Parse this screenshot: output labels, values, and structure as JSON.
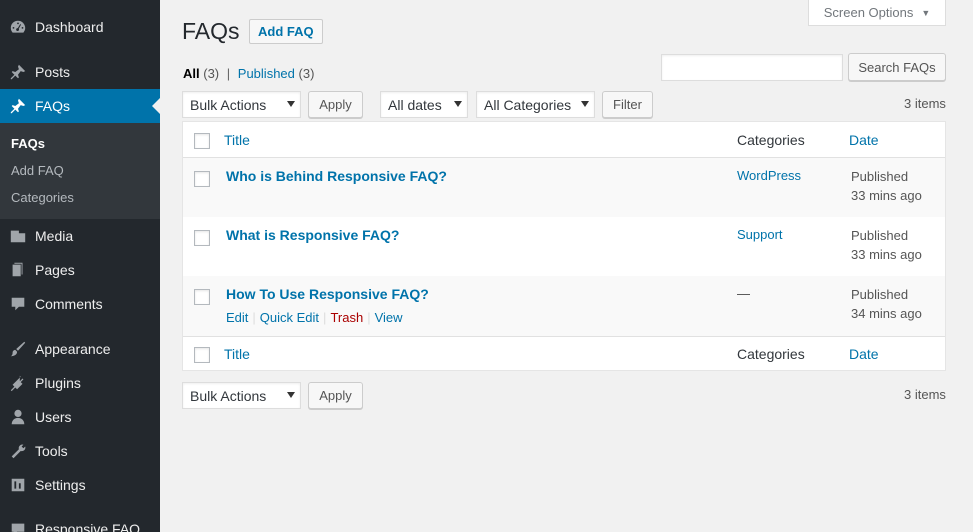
{
  "sidebar": {
    "items": [
      {
        "label": "Dashboard",
        "icon": "dashboard-icon"
      },
      {
        "label": "Posts",
        "icon": "pin-icon"
      },
      {
        "label": "FAQs",
        "icon": "pin-icon"
      },
      {
        "label": "Media",
        "icon": "media-icon"
      },
      {
        "label": "Pages",
        "icon": "pages-icon"
      },
      {
        "label": "Comments",
        "icon": "comments-icon"
      },
      {
        "label": "Appearance",
        "icon": "brush-icon"
      },
      {
        "label": "Plugins",
        "icon": "plugin-icon"
      },
      {
        "label": "Users",
        "icon": "users-icon"
      },
      {
        "label": "Tools",
        "icon": "wrench-icon"
      },
      {
        "label": "Settings",
        "icon": "settings-icon"
      },
      {
        "label": "Responsive FAQ",
        "icon": "faq-icon"
      }
    ],
    "submenu": [
      "FAQs",
      "Add FAQ",
      "Categories"
    ]
  },
  "header": {
    "screen_options": "Screen Options",
    "title": "FAQs",
    "add_new": "Add FAQ"
  },
  "filters_view": {
    "all_label": "All",
    "all_count": "(3)",
    "separator": "|",
    "published_label": "Published",
    "published_count": "(3)"
  },
  "search": {
    "value": "",
    "button": "Search FAQs"
  },
  "tablenav_top": {
    "bulk_actions": "Bulk Actions",
    "apply": "Apply",
    "dates": "All dates",
    "categories": "All Categories",
    "filter": "Filter",
    "items_count": "3 items"
  },
  "table": {
    "columns": {
      "title": "Title",
      "categories": "Categories",
      "date": "Date"
    },
    "rows": [
      {
        "title": "Who is Behind Responsive FAQ?",
        "category": "WordPress",
        "status": "Published",
        "time": "33 mins ago"
      },
      {
        "title": "What is Responsive FAQ?",
        "category": "Support",
        "status": "Published",
        "time": "33 mins ago"
      },
      {
        "title": "How To Use Responsive FAQ?",
        "category": "—",
        "status": "Published",
        "time": "34 mins ago",
        "actions": {
          "edit": "Edit",
          "quick_edit": "Quick Edit",
          "trash": "Trash",
          "view": "View",
          "sep": "|"
        }
      }
    ]
  },
  "tablenav_bottom": {
    "bulk_actions": "Bulk Actions",
    "apply": "Apply",
    "items_count": "3 items"
  },
  "colors": {
    "accent": "#0073aa",
    "sidebar": "#23282d",
    "trash": "#a00000"
  }
}
